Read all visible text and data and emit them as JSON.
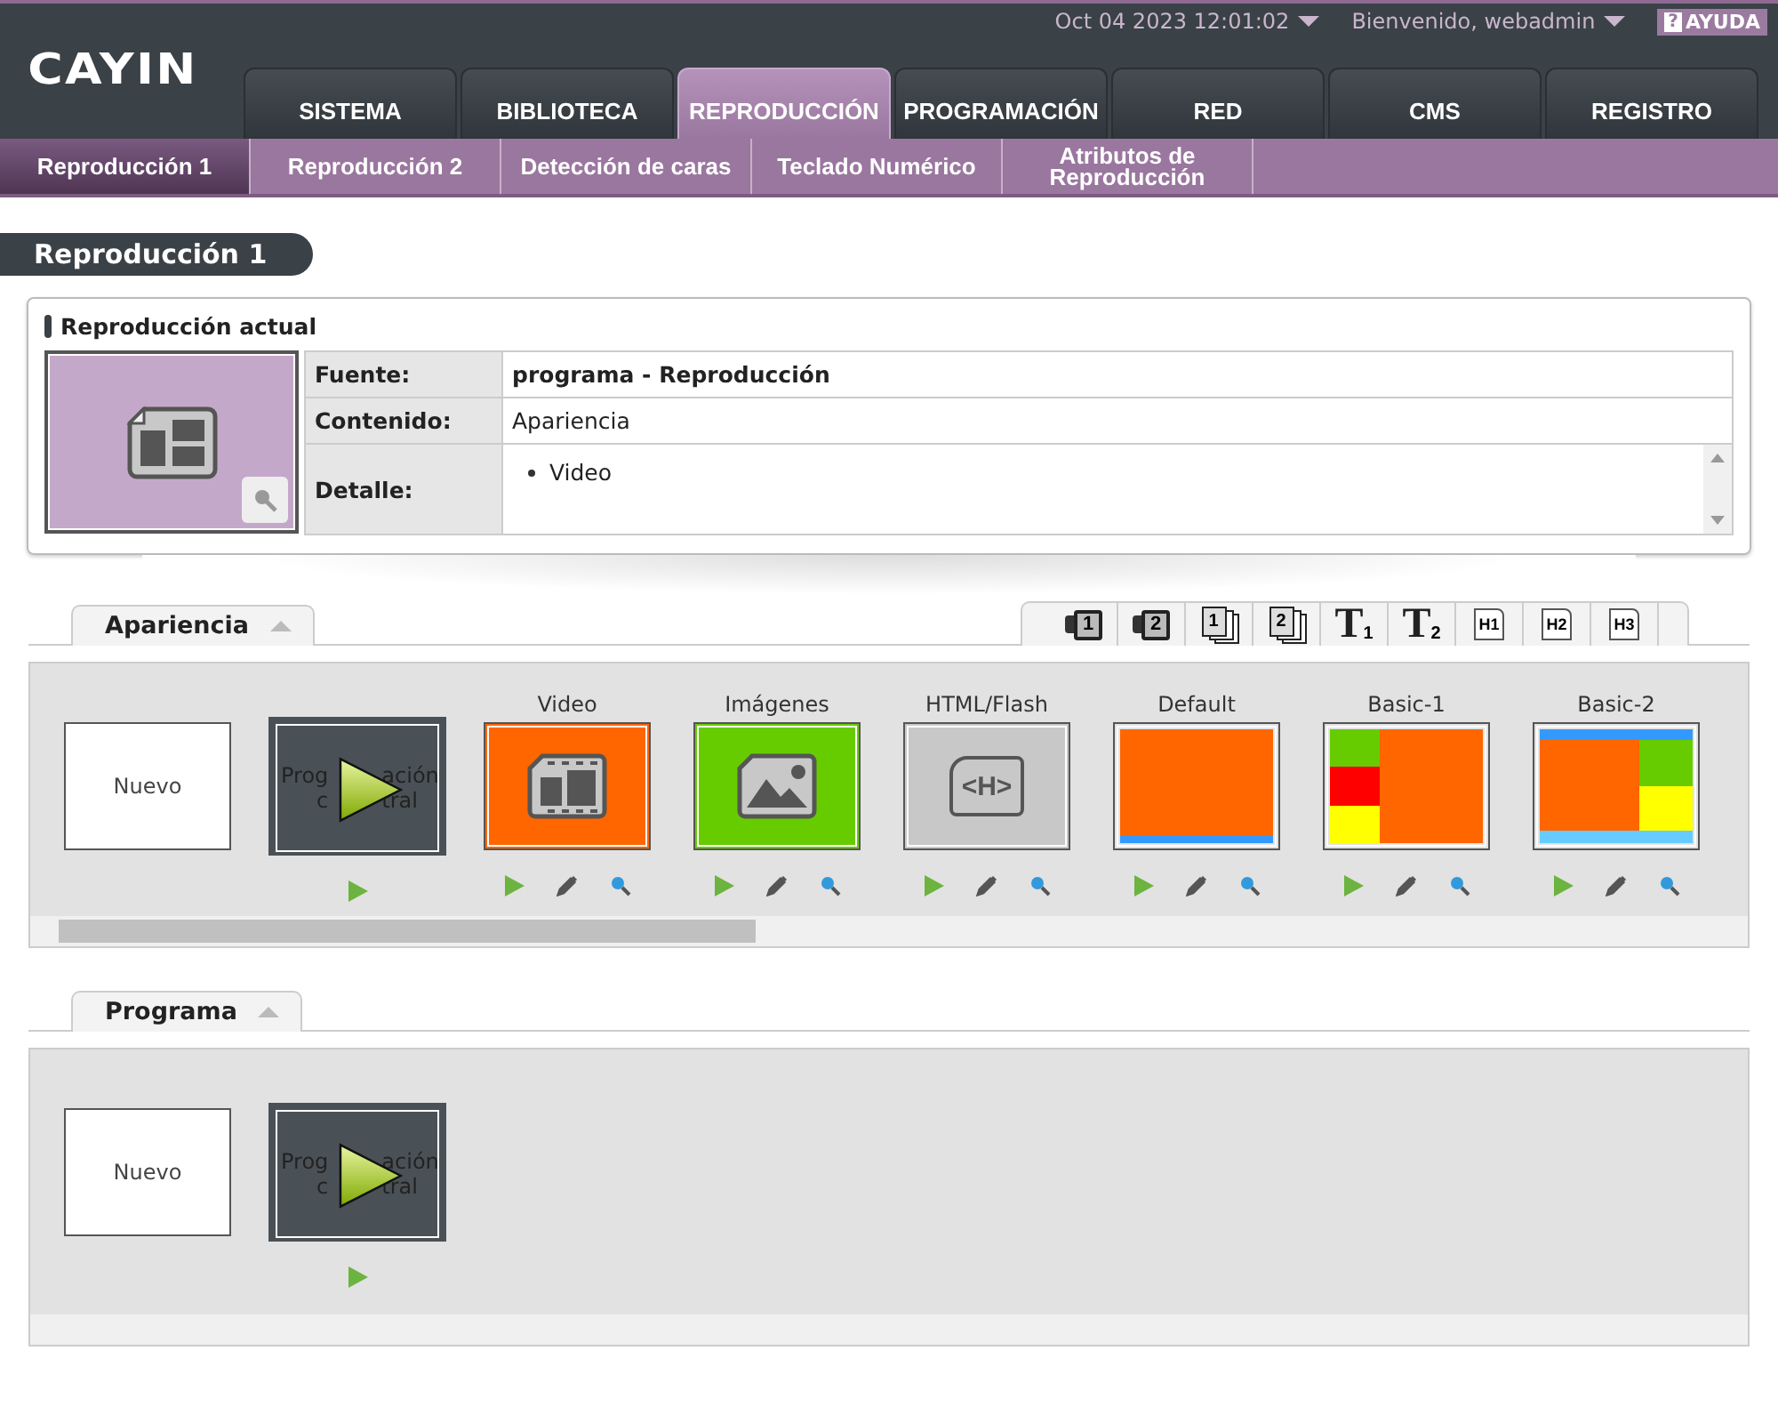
{
  "header": {
    "datetime": "Oct 04 2023 12:01:02",
    "user": "Bienvenido, webadmin",
    "help": "AYUDA",
    "help_icon": "?",
    "logo": "CAYIN"
  },
  "main_tabs": [
    {
      "label": "SISTEMA",
      "selected": false
    },
    {
      "label": "BIBLIOTECA",
      "selected": false
    },
    {
      "label": "REPRODUCCIÓN",
      "selected": true
    },
    {
      "label": "PROGRAMACIÓN",
      "selected": false
    },
    {
      "label": "RED",
      "selected": false
    },
    {
      "label": "CMS",
      "selected": false
    },
    {
      "label": "REGISTRO",
      "selected": false
    }
  ],
  "sub_tabs": [
    {
      "label": "Reproducción 1",
      "selected": true
    },
    {
      "label": "Reproducción 2",
      "selected": false
    },
    {
      "label": "Detección de caras",
      "selected": false
    },
    {
      "label": "Teclado Numérico",
      "selected": false
    },
    {
      "label": "Atributos de Reproducción",
      "selected": false
    }
  ],
  "page_title": "Reproducción 1",
  "current": {
    "title": "Reproducción actual",
    "rows": [
      {
        "label": "Fuente:",
        "value": "programa - Reproducción",
        "kind": "bold"
      },
      {
        "label": "Contenido:",
        "value": "Apariencia",
        "kind": "plain"
      },
      {
        "label": "Detalle:",
        "items": [
          "Video"
        ],
        "kind": "list"
      }
    ]
  },
  "sections": [
    {
      "title": "Apariencia",
      "toolbar": [
        {
          "kind": "camera",
          "label": "1"
        },
        {
          "kind": "camera",
          "label": "2"
        },
        {
          "kind": "pages",
          "label": "1"
        },
        {
          "kind": "pages",
          "label": "2"
        },
        {
          "kind": "type",
          "label": "T",
          "sub": "1"
        },
        {
          "kind": "type",
          "label": "T",
          "sub": "2"
        },
        {
          "kind": "heading",
          "label": "H1"
        },
        {
          "kind": "heading",
          "label": "H2"
        },
        {
          "kind": "heading",
          "label": "H3"
        }
      ],
      "items": [
        {
          "kind": "new",
          "label": "Nuevo"
        },
        {
          "kind": "program",
          "label_parts": [
            "Prog",
            "ación",
            "c",
            "tral"
          ]
        },
        {
          "kind": "video",
          "title": "Video",
          "color": "#ff6600"
        },
        {
          "kind": "image",
          "title": "Imágenes",
          "color": "#66cc00"
        },
        {
          "kind": "html",
          "title": "HTML/Flash",
          "icon_text": "<H>",
          "color": "#c8c8c8"
        },
        {
          "kind": "layout",
          "title": "Default",
          "regions": [
            {
              "color": "#ff6600"
            },
            {
              "color": "#3399ff"
            }
          ]
        },
        {
          "kind": "layout",
          "title": "Basic-1",
          "regions": [
            {
              "color": "#66cc00"
            },
            {
              "color": "#ff0000"
            },
            {
              "color": "#ffff00"
            },
            {
              "color": "#ff6600"
            }
          ]
        },
        {
          "kind": "layout",
          "title": "Basic-2",
          "regions": [
            {
              "color": "#3399ff"
            },
            {
              "color": "#ff6600"
            },
            {
              "color": "#66cc00"
            },
            {
              "color": "#ffff00"
            },
            {
              "color": "#66ccff"
            }
          ]
        }
      ]
    },
    {
      "title": "Programa",
      "items": [
        {
          "kind": "new",
          "label": "Nuevo"
        },
        {
          "kind": "program",
          "label_parts": [
            "Prog",
            "ación",
            "c",
            "tral"
          ]
        }
      ]
    }
  ]
}
